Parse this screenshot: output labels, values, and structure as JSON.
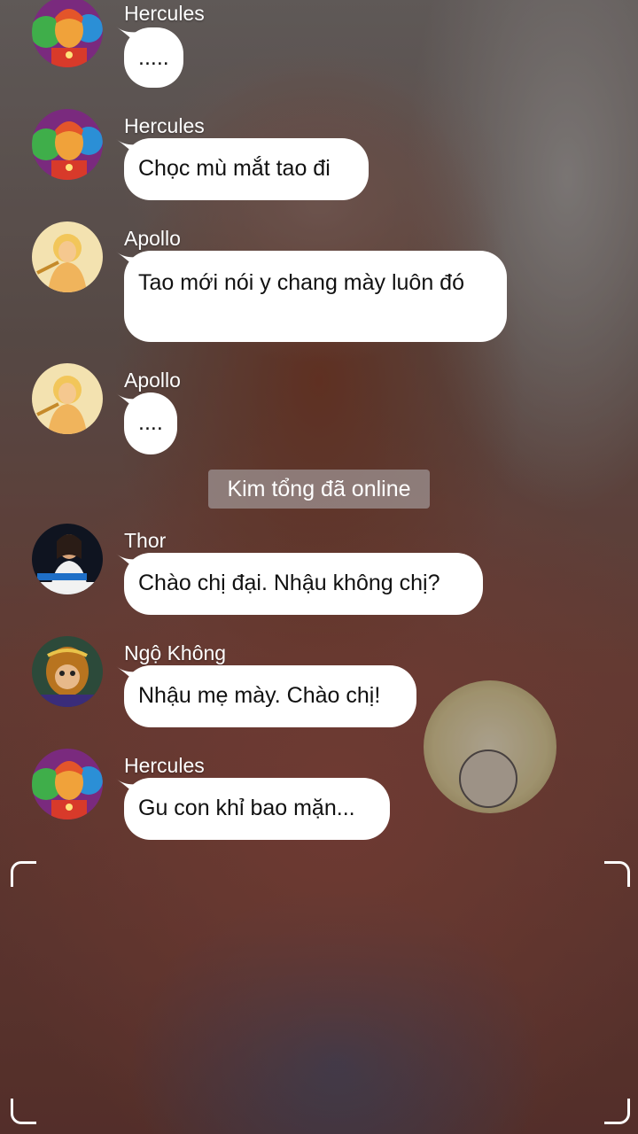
{
  "messages": [
    {
      "sender": "Hercules",
      "text": ".....",
      "avatar": "hercules-avatar"
    },
    {
      "sender": "Hercules",
      "text": "Chọc mù mắt tao đi",
      "avatar": "hercules-avatar"
    },
    {
      "sender": "Apollo",
      "text": "Tao mới nói y chang mày luôn đó",
      "avatar": "apollo-avatar"
    },
    {
      "sender": "Apollo",
      "text": "....",
      "avatar": "apollo-avatar"
    },
    {
      "sender": "Thor",
      "text": "Chào chị đại. Nhậu không chị?",
      "avatar": "thor-avatar"
    },
    {
      "sender": "Ngộ Không",
      "text": "Nhậu mẹ mày. Chào chị!",
      "avatar": "ngo-khong-avatar"
    },
    {
      "sender": "Hercules",
      "text": "Gu con khỉ bao mặn...",
      "avatar": "hercules-avatar"
    }
  ],
  "system_notice": "Kim tổng đã online",
  "colors": {
    "bubble": "#ffffff",
    "bubble_text": "#111111",
    "sender_text": "#ffffff",
    "notice_bg": "#a09696"
  }
}
